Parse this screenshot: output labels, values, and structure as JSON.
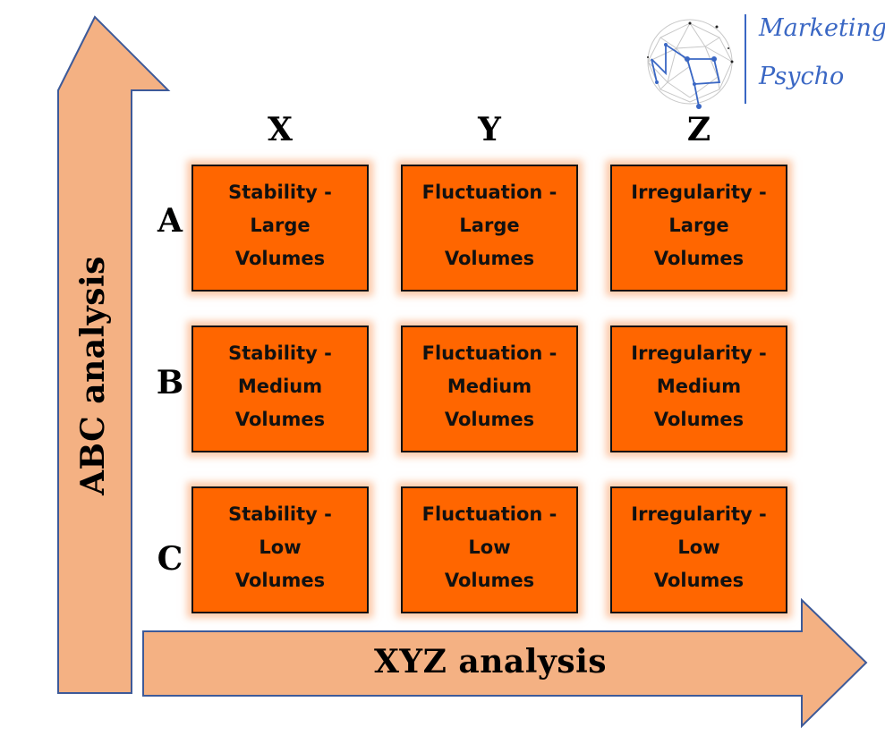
{
  "logo": {
    "line1": "Marketing",
    "line2": "Psycho",
    "color": "#3a67c4"
  },
  "axes": {
    "vertical_label": "ABC analysis",
    "horizontal_label": "XYZ analysis",
    "arrow_fill": "#f4b183",
    "arrow_stroke": "#3d5a99"
  },
  "columns": [
    "X",
    "Y",
    "Z"
  ],
  "rows": [
    "A",
    "B",
    "C"
  ],
  "cell_color": "#ff6600",
  "cells": [
    [
      {
        "line1": "Stability -",
        "line2": "Large",
        "line3": "Volumes"
      },
      {
        "line1": "Fluctuation -",
        "line2": "Large",
        "line3": "Volumes"
      },
      {
        "line1": "Irregularity -",
        "line2": "Large",
        "line3": "Volumes"
      }
    ],
    [
      {
        "line1": "Stability -",
        "line2": "Medium",
        "line3": "Volumes"
      },
      {
        "line1": "Fluctuation -",
        "line2": "Medium",
        "line3": "Volumes"
      },
      {
        "line1": "Irregularity -",
        "line2": "Medium",
        "line3": "Volumes"
      }
    ],
    [
      {
        "line1": "Stability -",
        "line2": "Low",
        "line3": "Volumes"
      },
      {
        "line1": "Fluctuation -",
        "line2": "Low",
        "line3": "Volumes"
      },
      {
        "line1": "Irregularity -",
        "line2": "Low",
        "line3": "Volumes"
      }
    ]
  ]
}
